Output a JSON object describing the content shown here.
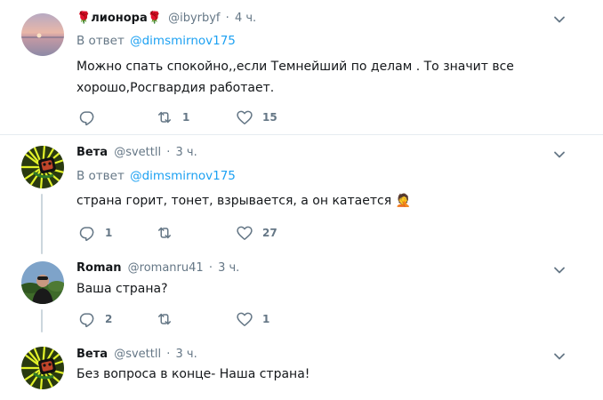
{
  "tweets": [
    {
      "name": "лионора",
      "name_prefix_emoji": "🌹",
      "name_suffix_emoji": "🌹",
      "handle": "@ibyrbyf",
      "time": "4 ч.",
      "reply_label": "В ответ",
      "reply_mention": "@dimsmirnov175",
      "text_lines": [
        "Можно спать спокойно,,если Темнейший по делам . То значит все",
        "хорошо,Росгвардия работает."
      ],
      "reply_count": "",
      "retweet_count": "1",
      "like_count": "15",
      "avatar": "sunset-sea-avatar"
    },
    {
      "name": "Вета",
      "handle": "@svettll",
      "time": "3 ч.",
      "reply_label": "В ответ",
      "reply_mention": "@dimsmirnov175",
      "text": "страна горит, тонет, взрывается, а он катается 🤦",
      "reply_count": "1",
      "retweet_count": "",
      "like_count": "27",
      "avatar": "graffiti-avatar"
    },
    {
      "name": "Roman",
      "handle": "@romanru41",
      "time": "3 ч.",
      "text": "Ваша страна?",
      "reply_count": "2",
      "retweet_count": "",
      "like_count": "1",
      "avatar": "man-outdoor-avatar"
    },
    {
      "name": "Вета",
      "handle": "@svettll",
      "time": "3 ч.",
      "text": "Без вопроса в конце- Наша страна!",
      "avatar": "graffiti-avatar"
    }
  ],
  "dot": "·",
  "colors": {
    "link": "#1da1f2",
    "muted": "#657786",
    "divider": "#e6ecf0",
    "thread": "#ccd6dd"
  }
}
